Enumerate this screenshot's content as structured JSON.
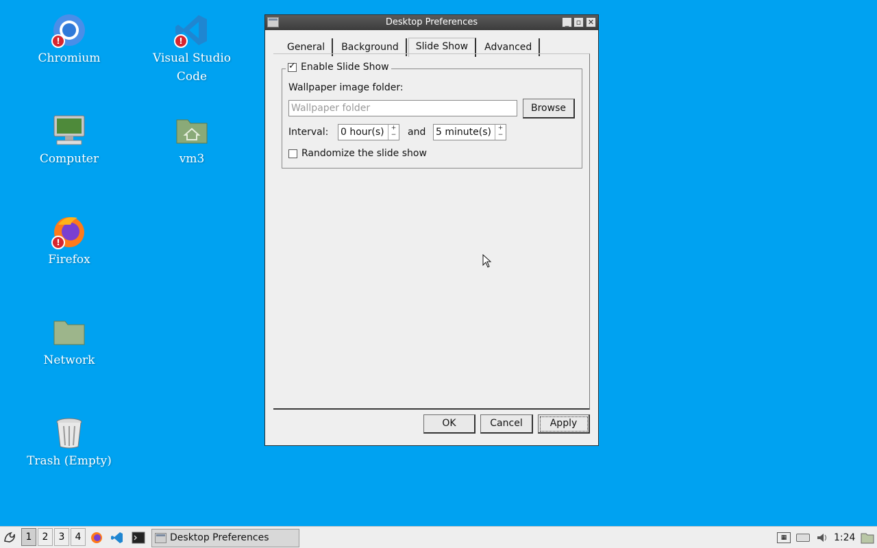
{
  "desktop": {
    "icons": [
      {
        "label": "Chromium",
        "icon": "chromium-icon"
      },
      {
        "label": "Visual Studio Code",
        "icon": "vscode-icon"
      },
      {
        "label": "Computer",
        "icon": "computer-icon"
      },
      {
        "label": "vm3",
        "icon": "home-folder-icon"
      },
      {
        "label": "Firefox",
        "icon": "firefox-icon"
      },
      {
        "label": "Network",
        "icon": "network-folder-icon"
      },
      {
        "label": "Trash (Empty)",
        "icon": "trash-icon"
      }
    ],
    "badge_glyph": "!"
  },
  "dialog": {
    "title": "Desktop Preferences",
    "tabs": [
      "General",
      "Background",
      "Slide Show",
      "Advanced"
    ],
    "active_tab": "Slide Show",
    "enable_slideshow": {
      "label": "Enable Slide Show",
      "checked": true
    },
    "folder_label": "Wallpaper image folder:",
    "folder_placeholder": "Wallpaper folder",
    "folder_value": "",
    "browse_label": "Browse",
    "interval_label": "Interval:",
    "hours_value": "0 hour(s)",
    "and_label": "and",
    "minutes_value": "5 minute(s)",
    "randomize": {
      "label": "Randomize the slide show",
      "checked": false
    },
    "ok_label": "OK",
    "cancel_label": "Cancel",
    "apply_label": "Apply"
  },
  "taskbar": {
    "workspaces": [
      "1",
      "2",
      "3",
      "4"
    ],
    "active_workspace": "1",
    "task_label": "Desktop Preferences",
    "clock": "1:24",
    "keyboard_layout": "kbd"
  },
  "colors": {
    "desktop_bg": "#00a2f1",
    "titlebar": "#4a4a4a",
    "badge": "#d7262f"
  }
}
